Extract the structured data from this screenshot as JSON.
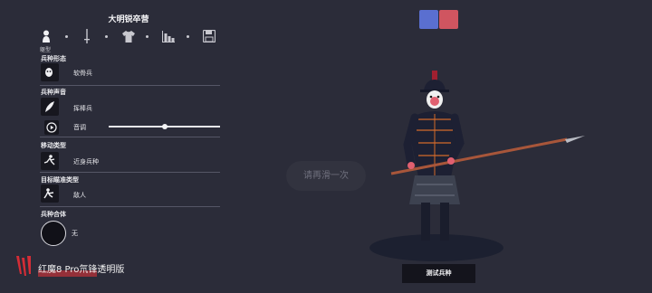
{
  "panel": {
    "title": "大明锐卒营",
    "tabs": [
      {
        "name": "body",
        "label": "躯型"
      },
      {
        "name": "weapon",
        "label": ""
      },
      {
        "name": "outfit",
        "label": ""
      },
      {
        "name": "stats",
        "label": ""
      },
      {
        "name": "save",
        "label": ""
      }
    ],
    "body_form": {
      "title": "兵种形态",
      "value": "软骨兵"
    },
    "voice": {
      "title": "兵种声音",
      "value": "挥棒兵",
      "pitch_label": "音调",
      "pitch_level": 0.5
    },
    "movement": {
      "title": "移动类型",
      "value": "近身兵种"
    },
    "target": {
      "title": "目标瞄准类型",
      "value": "敌人"
    },
    "combine": {
      "title": "兵种合体",
      "value": "无"
    }
  },
  "team_colors": [
    "#5a6fd0",
    "#d05560"
  ],
  "viewport": {
    "hint": "请再滑一次",
    "test_button": "测试兵种"
  },
  "watermark": "红魔8 Pro氘锋透明版"
}
